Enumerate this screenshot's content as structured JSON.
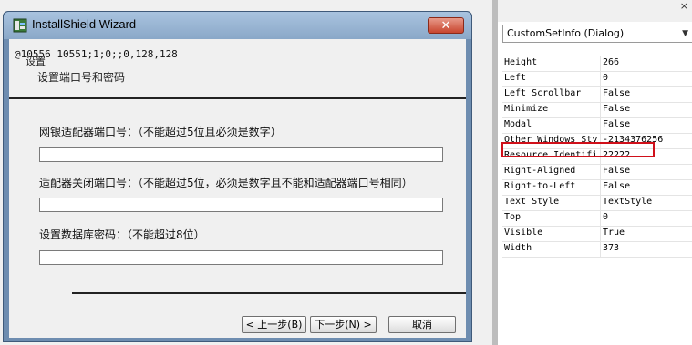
{
  "dialog": {
    "title": "InstallShield Wizard",
    "close_label": "✕",
    "debug_text": "@10556  10551;1;0;;0,128,128",
    "subtitle_small": "设置",
    "subtitle": "设置端口号和密码",
    "fields": [
      {
        "label": "网银适配器端口号：（不能超过5位且必须是数字）",
        "value": ""
      },
      {
        "label": "适配器关闭端口号：（不能超过5位，必须是数字且不能和适配器端口号相同）",
        "value": ""
      },
      {
        "label": "设置数据库密码：（不能超过8位）",
        "value": ""
      }
    ],
    "buttons": {
      "back": "< 上一步(B)",
      "next": "下一步(N) >",
      "cancel": "取消"
    }
  },
  "properties_panel": {
    "top_glyph": "×",
    "combo_value": "CustomSetInfo (Dialog)",
    "rows": [
      {
        "key": "Height",
        "value": "266"
      },
      {
        "key": "Left",
        "value": "0"
      },
      {
        "key": "Left Scrollbar",
        "value": "False"
      },
      {
        "key": "Minimize",
        "value": "False"
      },
      {
        "key": "Modal",
        "value": "False"
      },
      {
        "key": "Other Windows Sty",
        "value": "-2134376256"
      },
      {
        "key": "Resource Identifi",
        "value": "22222"
      },
      {
        "key": "Right-Aligned",
        "value": "False"
      },
      {
        "key": "Right-to-Left",
        "value": "False"
      },
      {
        "key": "Text Style",
        "value": "TextStyle"
      },
      {
        "key": "Top",
        "value": "0"
      },
      {
        "key": "Visible",
        "value": "True"
      },
      {
        "key": "Width",
        "value": "373"
      }
    ]
  },
  "colors": {
    "highlight": "#d0101a",
    "titlebar": "#a9c3df"
  }
}
